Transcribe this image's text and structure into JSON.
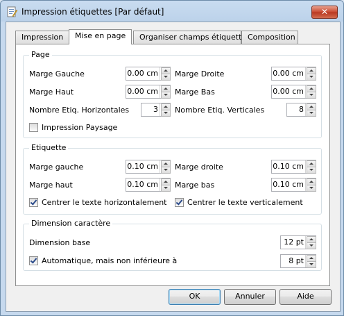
{
  "window": {
    "title": "Impression étiquettes [Par défaut]",
    "close_label": "✕"
  },
  "tabs": [
    {
      "label": "Impression"
    },
    {
      "label": "Mise en page"
    },
    {
      "label": "Organiser champs étiquette"
    },
    {
      "label": "Composition"
    }
  ],
  "page_group": {
    "title": "Page",
    "marge_gauche": {
      "label": "Marge Gauche",
      "value": "0.00 cm"
    },
    "marge_droite": {
      "label": "Marge Droite",
      "value": "0.00 cm"
    },
    "marge_haut": {
      "label": "Marge Haut",
      "value": "0.00 cm"
    },
    "marge_bas": {
      "label": "Marge Bas",
      "value": "0.00 cm"
    },
    "nb_horiz": {
      "label": "Nombre Etiq. Horizontales",
      "value": "3"
    },
    "nb_vert": {
      "label": "Nombre Etiq. Verticales",
      "value": "8"
    },
    "paysage": {
      "label": "Impression Paysage",
      "checked": false
    }
  },
  "etiquette_group": {
    "title": "Etiquette",
    "marge_gauche": {
      "label": "Marge gauche",
      "value": "0.10 cm"
    },
    "marge_droite": {
      "label": "Marge droite",
      "value": "0.10 cm"
    },
    "marge_haut": {
      "label": "Marge haut",
      "value": "0.10 cm"
    },
    "marge_bas": {
      "label": "Marge bas",
      "value": "0.10 cm"
    },
    "centrer_h": {
      "label": "Centrer le texte horizontalement",
      "checked": true
    },
    "centrer_v": {
      "label": "Centrer le texte verticalement",
      "checked": true
    }
  },
  "dimension_group": {
    "title": "Dimension caractère",
    "base": {
      "label": "Dimension base",
      "value": "12 pt"
    },
    "auto": {
      "label": "Automatique, mais non inférieure à",
      "checked": true,
      "value": "8 pt"
    }
  },
  "buttons": {
    "ok": "OK",
    "cancel": "Annuler",
    "help": "Aide"
  }
}
